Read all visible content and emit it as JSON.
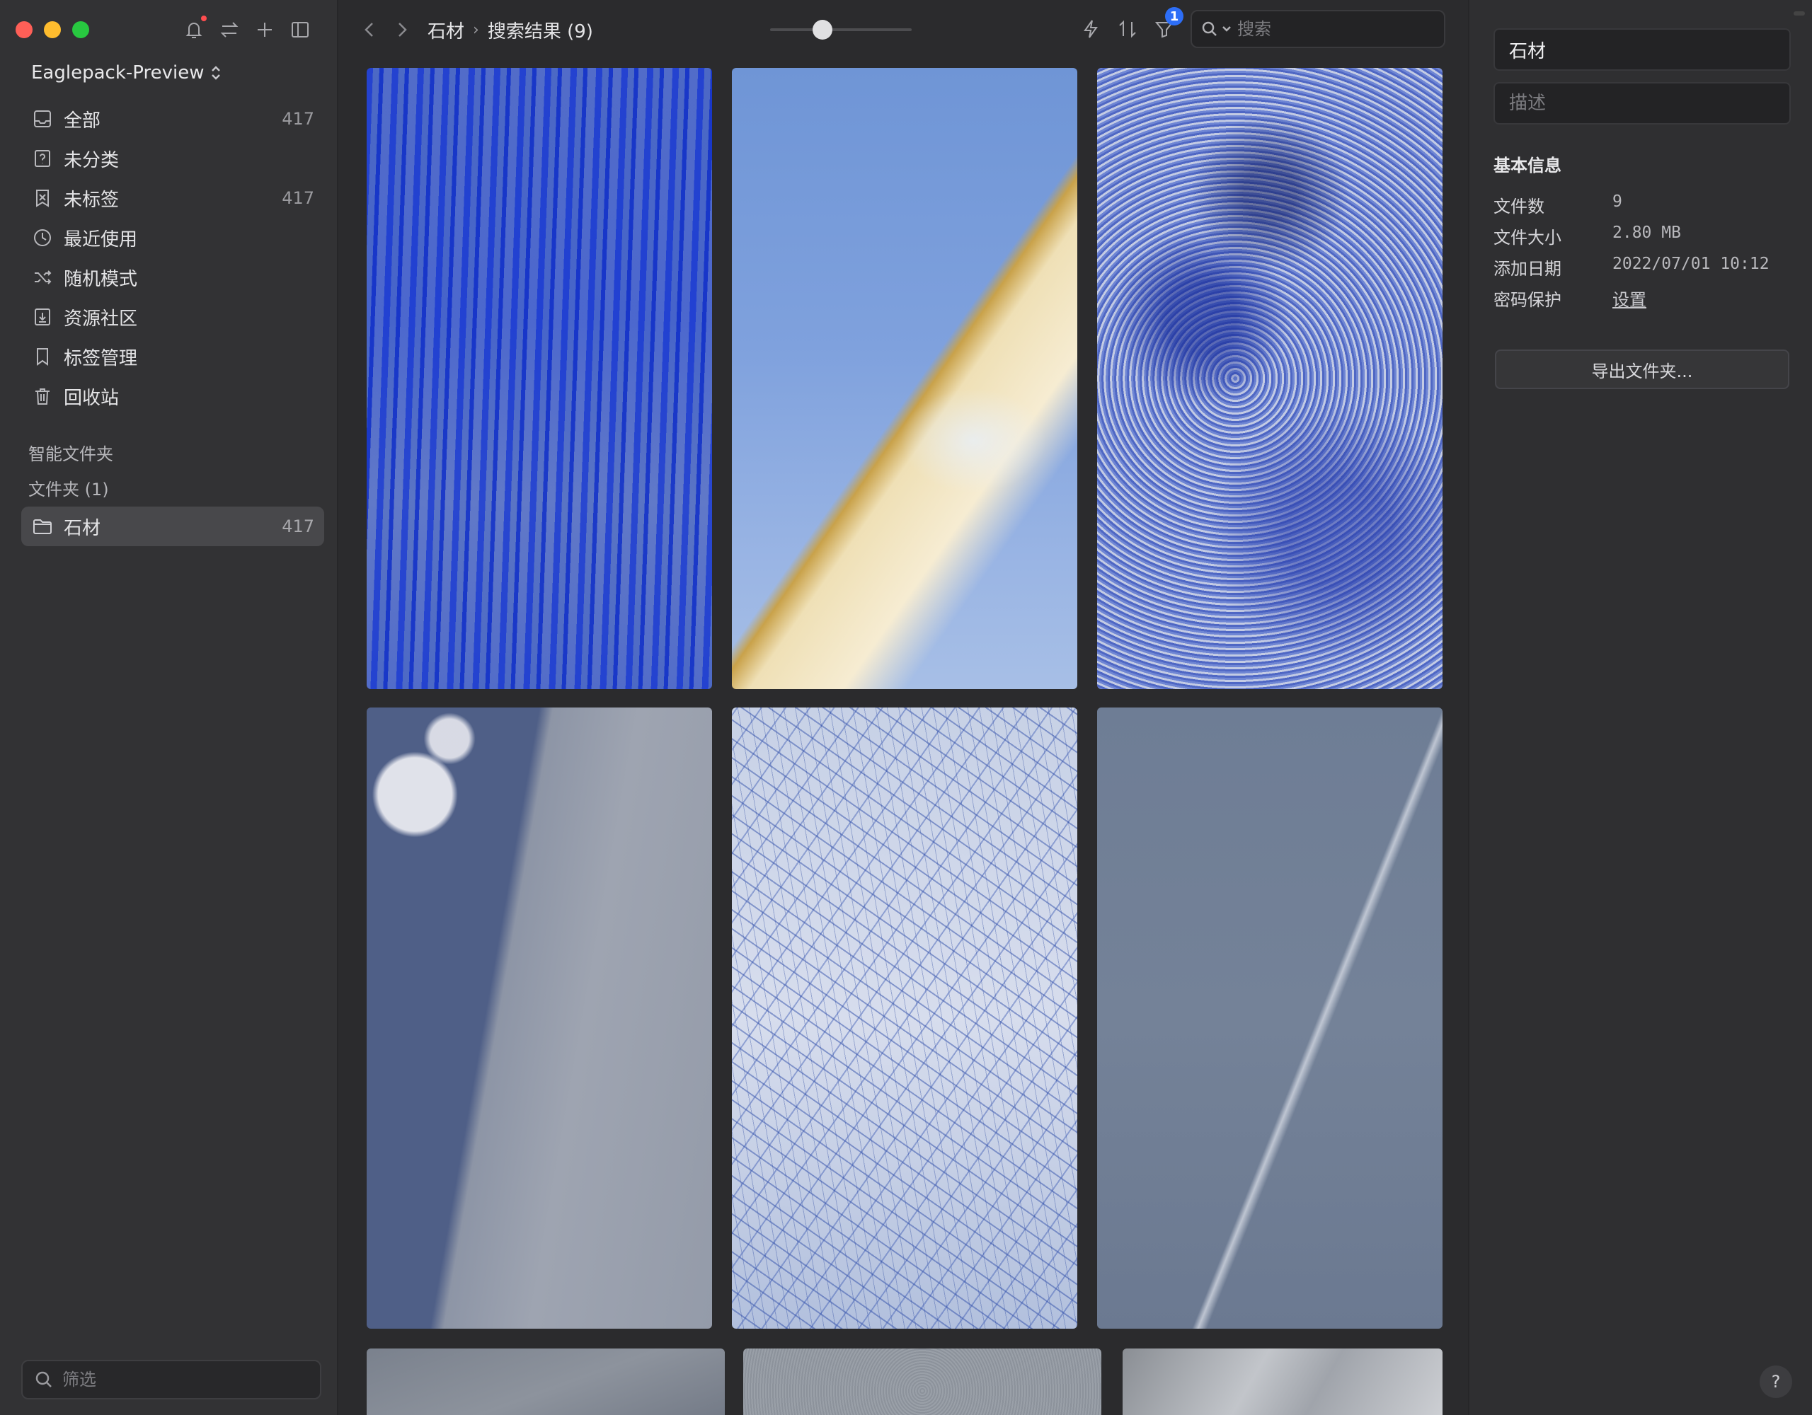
{
  "sidebar": {
    "library_name": "Eaglepack-Preview",
    "nav": [
      {
        "label": "全部",
        "count": "417",
        "icon": "inbox-icon"
      },
      {
        "label": "未分类",
        "count": "",
        "icon": "question-square-icon"
      },
      {
        "label": "未标签",
        "count": "417",
        "icon": "tag-off-icon"
      },
      {
        "label": "最近使用",
        "count": "",
        "icon": "clock-icon"
      },
      {
        "label": "随机模式",
        "count": "",
        "icon": "shuffle-icon"
      },
      {
        "label": "资源社区",
        "count": "",
        "icon": "download-box-icon"
      },
      {
        "label": "标签管理",
        "count": "",
        "icon": "bookmark-icon"
      },
      {
        "label": "回收站",
        "count": "",
        "icon": "trash-icon"
      }
    ],
    "smart_folders_label": "智能文件夹",
    "folders_label": "文件夹 (1)",
    "folder": {
      "label": "石材",
      "count": "417"
    },
    "filter_placeholder": "筛选"
  },
  "toolbar": {
    "breadcrumb_root": "石材",
    "breadcrumb_current": "搜索结果 (9)",
    "zoom_level": 0.35,
    "filter_badge": "1",
    "search_placeholder": "搜索"
  },
  "inspector": {
    "name": "石材",
    "description_placeholder": "描述",
    "section_title": "基本信息",
    "rows": [
      {
        "key": "文件数",
        "value": "9"
      },
      {
        "key": "文件大小",
        "value": "2.80 MB"
      },
      {
        "key": "添加日期",
        "value": "2022/07/01 10:12"
      },
      {
        "key": "密码保护",
        "value": "设置"
      }
    ],
    "export_label": "导出文件夹...",
    "help_label": "?"
  },
  "colors": {
    "accent": "#2d6ef7",
    "notification": "#ff4d4f",
    "selected_row": "#48484b"
  }
}
